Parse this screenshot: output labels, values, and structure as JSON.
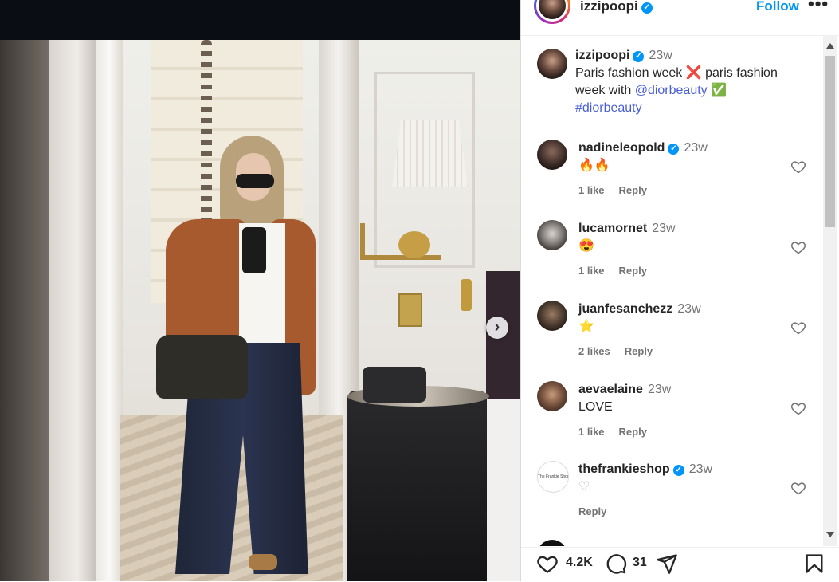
{
  "post": {
    "author": "izzipoopi",
    "follow_label": "Follow",
    "more_label": "•••",
    "caption_time": "23w",
    "caption_line1": "Paris fashion week",
    "caption_cross": "❌",
    "caption_line1b": "paris fashion",
    "caption_line2a": "week with",
    "caption_mention": "@diorbeauty",
    "caption_check": "✅",
    "caption_hashtag": "#diorbeauty"
  },
  "comments": [
    {
      "user": "nadineleopold",
      "verified": true,
      "time": "23w",
      "text": "🔥🔥",
      "likes": "1 like",
      "reply": "Reply"
    },
    {
      "user": "lucamornet",
      "verified": false,
      "time": "23w",
      "text": "😍",
      "likes": "1 like",
      "reply": "Reply"
    },
    {
      "user": "juanfesanchezz",
      "verified": false,
      "time": "23w",
      "text": "⭐",
      "likes": "2 likes",
      "reply": "Reply"
    },
    {
      "user": "aevaelaine",
      "verified": false,
      "time": "23w",
      "text": "LOVE",
      "likes": "1 like",
      "reply": "Reply"
    },
    {
      "user": "thefrankieshop",
      "verified": true,
      "time": "23w",
      "text": "♡",
      "likes": "",
      "reply": "Reply",
      "avatar_text": "The Frankie Shop"
    }
  ],
  "footer": {
    "likes_count": "4.2K",
    "comments_count": "31"
  },
  "icons": {
    "verified": "verified-badge-icon",
    "heart": "heart-icon",
    "comment": "comment-icon",
    "share": "share-icon",
    "save": "bookmark-icon",
    "next": "chevron-right-icon"
  },
  "colors": {
    "accent": "#0095f6",
    "text": "#262626",
    "muted": "#737373"
  }
}
